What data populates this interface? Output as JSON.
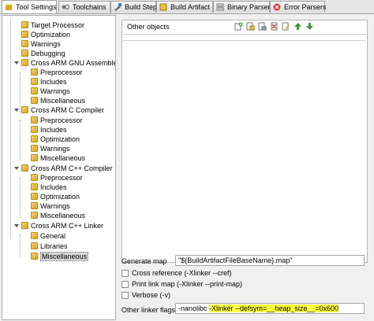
{
  "tabs": [
    {
      "label": "Tool Settings",
      "icon": "tool-settings-icon"
    },
    {
      "label": "Toolchains",
      "icon": "toolchains-icon"
    },
    {
      "label": "Build Steps",
      "icon": "build-steps-icon"
    },
    {
      "label": "Build Artifact",
      "icon": "build-artifact-icon"
    },
    {
      "label": "Binary Parsers",
      "icon": "binary-parsers-icon"
    },
    {
      "label": "Error Parsers",
      "icon": "error-parsers-icon"
    }
  ],
  "tree": {
    "items": [
      {
        "label": "Target Processor"
      },
      {
        "label": "Optimization"
      },
      {
        "label": "Warnings"
      },
      {
        "label": "Debugging"
      },
      {
        "label": "Cross ARM GNU Assembler"
      },
      {
        "label": "Preprocessor"
      },
      {
        "label": "Includes"
      },
      {
        "label": "Warnings"
      },
      {
        "label": "Miscellaneous"
      },
      {
        "label": "Cross ARM C Compiler"
      },
      {
        "label": "Preprocessor"
      },
      {
        "label": "Includes"
      },
      {
        "label": "Optimization"
      },
      {
        "label": "Warnings"
      },
      {
        "label": "Miscellaneous"
      },
      {
        "label": "Cross ARM C++ Compiler"
      },
      {
        "label": "Preprocessor"
      },
      {
        "label": "Includes"
      },
      {
        "label": "Optimization"
      },
      {
        "label": "Warnings"
      },
      {
        "label": "Miscellaneous"
      },
      {
        "label": "Cross ARM C++ Linker"
      },
      {
        "label": "General"
      },
      {
        "label": "Libraries"
      },
      {
        "label": "Miscellaneous"
      }
    ]
  },
  "objects": {
    "title": "Other objects",
    "toolbar_icons": [
      "add-icon",
      "add-workspace-icon",
      "add-filesystem-icon",
      "delete-icon",
      "edit-icon",
      "move-up-icon",
      "move-down-icon"
    ]
  },
  "form": {
    "generate_map_label": "Generate map",
    "generate_map_value": "\"${BuildArtifactFileBaseName}.map\"",
    "cross_reference_label": "Cross reference (-Xlinker --cref)",
    "print_link_map_label": "Print link map (-Xlinker --print-map)",
    "verbose_label": "Verbose (-v)",
    "other_flags_label": "Other linker flags",
    "other_flags_plain": "-nanolibc ",
    "other_flags_highlight": "-Xlinker --defsym=__heap_size__=0x600"
  },
  "colors": {
    "highlight": "#ffff40",
    "selection": "#d6d6d6"
  }
}
